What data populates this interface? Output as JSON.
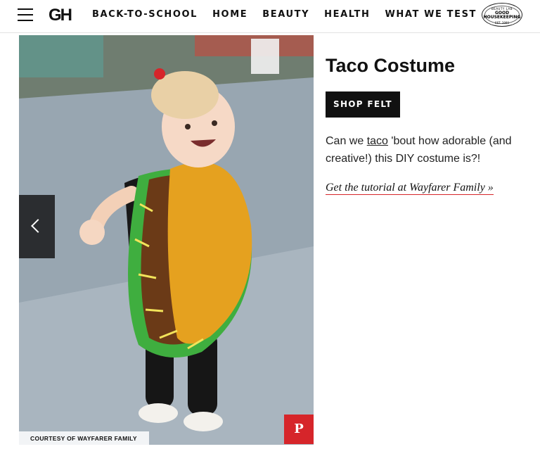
{
  "header": {
    "logo": "GH",
    "nav": [
      "BACK-TO-SCHOOL",
      "HOME",
      "BEAUTY",
      "HEALTH",
      "WHAT WE TEST"
    ],
    "seal": {
      "top": "BEAUTY LAB",
      "line1": "GOOD",
      "line2": "HOUSEKEEPING",
      "bottom": "EST. 1900"
    }
  },
  "slide": {
    "credit": "COURTESY OF WAYFARER FAMILY",
    "pin_icon_glyph": "P",
    "prev_icon": "chevron-left-icon"
  },
  "article": {
    "title": "Taco Costume",
    "shop_button": "SHOP FELT",
    "desc_before": "Can we ",
    "desc_link": "taco",
    "desc_after": " 'bout how adorable (and creative!) this DIY costume is?!",
    "tutorial_link": "Get the tutorial at Wayfarer Family »"
  },
  "colors": {
    "accent_red": "#d6252a",
    "button_dark": "#111111",
    "taco_yellow": "#e5a11f",
    "taco_brown": "#6b3a17",
    "lettuce_green": "#3fae3f"
  }
}
